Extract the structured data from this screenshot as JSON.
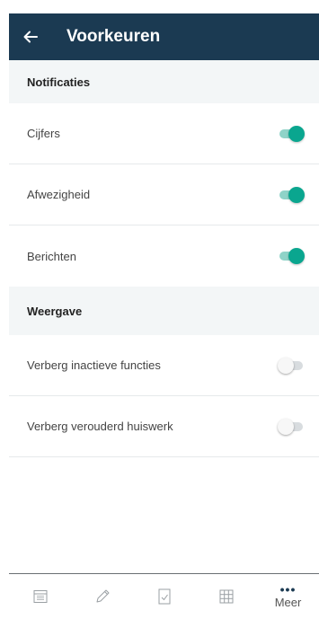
{
  "header": {
    "title": "Voorkeuren",
    "back_icon": "arrow-left-icon"
  },
  "sections": [
    {
      "title": "Notificaties",
      "items": [
        {
          "label": "Cijfers",
          "enabled": true
        },
        {
          "label": "Afwezigheid",
          "enabled": true
        },
        {
          "label": "Berichten",
          "enabled": true
        }
      ]
    },
    {
      "title": "Weergave",
      "items": [
        {
          "label": "Verberg inactieve functies",
          "enabled": false
        },
        {
          "label": "Verberg verouderd huiswerk",
          "enabled": false
        }
      ]
    }
  ],
  "tabbar": {
    "tabs": [
      {
        "icon": "calendar-icon"
      },
      {
        "icon": "pencil-icon"
      },
      {
        "icon": "checklist-icon"
      },
      {
        "icon": "grid-icon"
      },
      {
        "icon": "more-icon",
        "label": "Meer"
      }
    ]
  },
  "colors": {
    "header_bg": "#1b3a52",
    "accent": "#0aa68f",
    "section_bg": "#f3f6f7"
  }
}
